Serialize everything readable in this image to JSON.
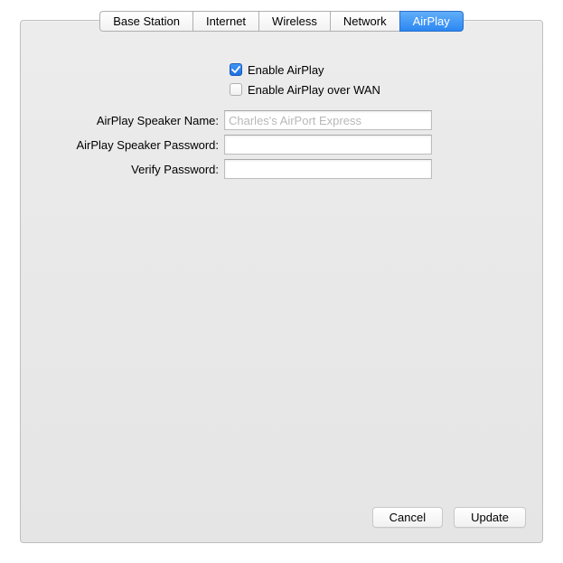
{
  "tabs": {
    "base_station": "Base Station",
    "internet": "Internet",
    "wireless": "Wireless",
    "network": "Network",
    "airplay": "AirPlay"
  },
  "form": {
    "enable_airplay": {
      "label": "Enable AirPlay",
      "checked": true
    },
    "enable_airplay_wan": {
      "label": "Enable AirPlay over WAN",
      "checked": false
    },
    "speaker_name": {
      "label": "AirPlay Speaker Name:",
      "placeholder": "Charles's AirPort Express",
      "value": ""
    },
    "speaker_password": {
      "label": "AirPlay Speaker Password:",
      "value": ""
    },
    "verify_password": {
      "label": "Verify Password:",
      "value": ""
    }
  },
  "buttons": {
    "cancel": "Cancel",
    "update": "Update"
  }
}
